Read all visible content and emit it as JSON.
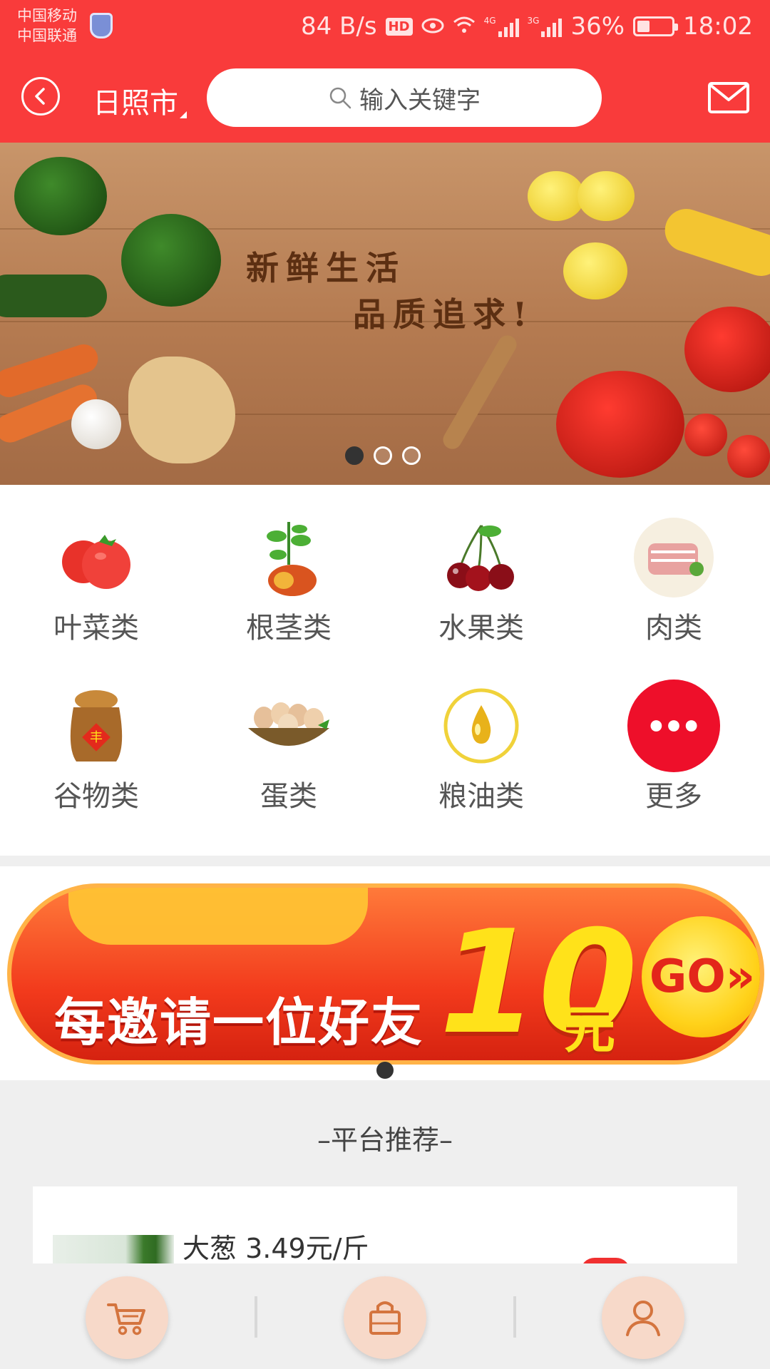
{
  "status_bar": {
    "carrier_1": "中国移动",
    "carrier_2": "中国联通",
    "net_speed": "84 B/s",
    "hd": "HD",
    "net_4g": "4G",
    "net_3g": "3G",
    "battery": "36%",
    "time": "18:02",
    "battery_level": 0.36
  },
  "header": {
    "city": "日照市",
    "search_placeholder": "输入关键字",
    "accent_color": "#f93b3b"
  },
  "banner": {
    "line1": "新鲜生活",
    "line2": "品质追求!",
    "slide_count": 3,
    "active_slide": 1
  },
  "categories": [
    {
      "label": "叶菜类",
      "icon": "tomato-icon"
    },
    {
      "label": "根茎类",
      "icon": "sweet-potato-icon"
    },
    {
      "label": "水果类",
      "icon": "cherry-icon"
    },
    {
      "label": "肉类",
      "icon": "meat-icon"
    },
    {
      "label": "谷物类",
      "icon": "grain-sack-icon"
    },
    {
      "label": "蛋类",
      "icon": "eggs-basket-icon"
    },
    {
      "label": "粮油类",
      "icon": "oil-drop-icon"
    },
    {
      "label": "更多",
      "icon": "more-dots-icon"
    }
  ],
  "invite": {
    "text": "每邀请一位好友",
    "amount": "10",
    "unit": "元",
    "go": "GO»"
  },
  "recommend": {
    "title": "–平台推荐–",
    "items": [
      {
        "name": "大葱 3.49元/斤"
      }
    ]
  },
  "tabbar": [
    {
      "icon": "cart-icon"
    },
    {
      "icon": "shopping-bag-icon"
    },
    {
      "icon": "user-icon"
    }
  ]
}
